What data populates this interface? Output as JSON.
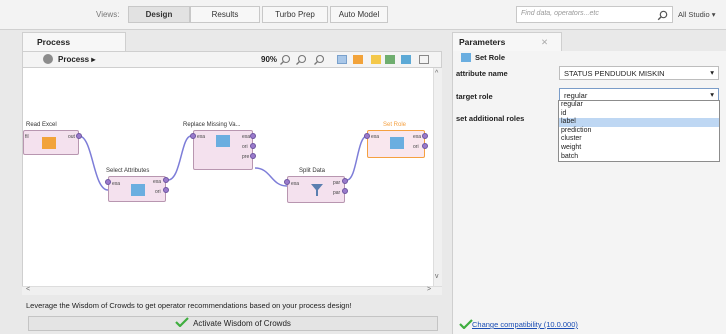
{
  "top": {
    "views_label": "Views:",
    "tabs": [
      "Design",
      "Results",
      "Turbo Prep",
      "Auto Model"
    ],
    "search_placeholder": "Find data, operators...etc",
    "studio_label": "All Studio ▾"
  },
  "process": {
    "tab_label": "Process",
    "breadcrumb": "Process ▸",
    "zoom": "90%",
    "operators": {
      "read_excel": {
        "label": "Read Excel",
        "port_out": "out",
        "port_in": "fil"
      },
      "select_attributes": {
        "label": "Select Attributes",
        "ports_in": [
          "exa"
        ],
        "ports_out": [
          "exa",
          "ori"
        ]
      },
      "replace_missing": {
        "label": "Replace Missing Va...",
        "ports_in": [
          "exa"
        ],
        "ports_out": [
          "exa",
          "ori",
          "pre"
        ]
      },
      "split_data": {
        "label": "Split Data",
        "ports_in": [
          "exa"
        ],
        "ports_out": [
          "par",
          "par"
        ]
      },
      "set_role": {
        "label": "Set Role",
        "ports_in": [
          "exa"
        ],
        "ports_out": [
          "exa",
          "ori"
        ]
      }
    },
    "wisdom_text": "Leverage the Wisdom of Crowds to get operator recommendations based on your process design!",
    "wisdom_button": "Activate Wisdom of Crowds"
  },
  "parameters": {
    "tab_label": "Parameters",
    "operator_name": "Set Role",
    "rows": {
      "attribute_name_label": "attribute name",
      "attribute_name_value": "STATUS PENDUDUK MISKIN",
      "target_role_label": "target role",
      "target_role_value": "regular",
      "additional_roles_label": "set additional roles"
    },
    "role_options": [
      "regular",
      "id",
      "label",
      "prediction",
      "cluster",
      "weight",
      "batch"
    ],
    "highlighted_option": "label",
    "compat_link": "Change compatibility (10.0.000)"
  },
  "colors": {
    "operator_fill": "#f4e1ee",
    "selected_border": "#f5a040",
    "selected_label": "#f5a040",
    "port": "#9a7acb",
    "link": "#1a4db4",
    "check": "#3fae3f"
  }
}
